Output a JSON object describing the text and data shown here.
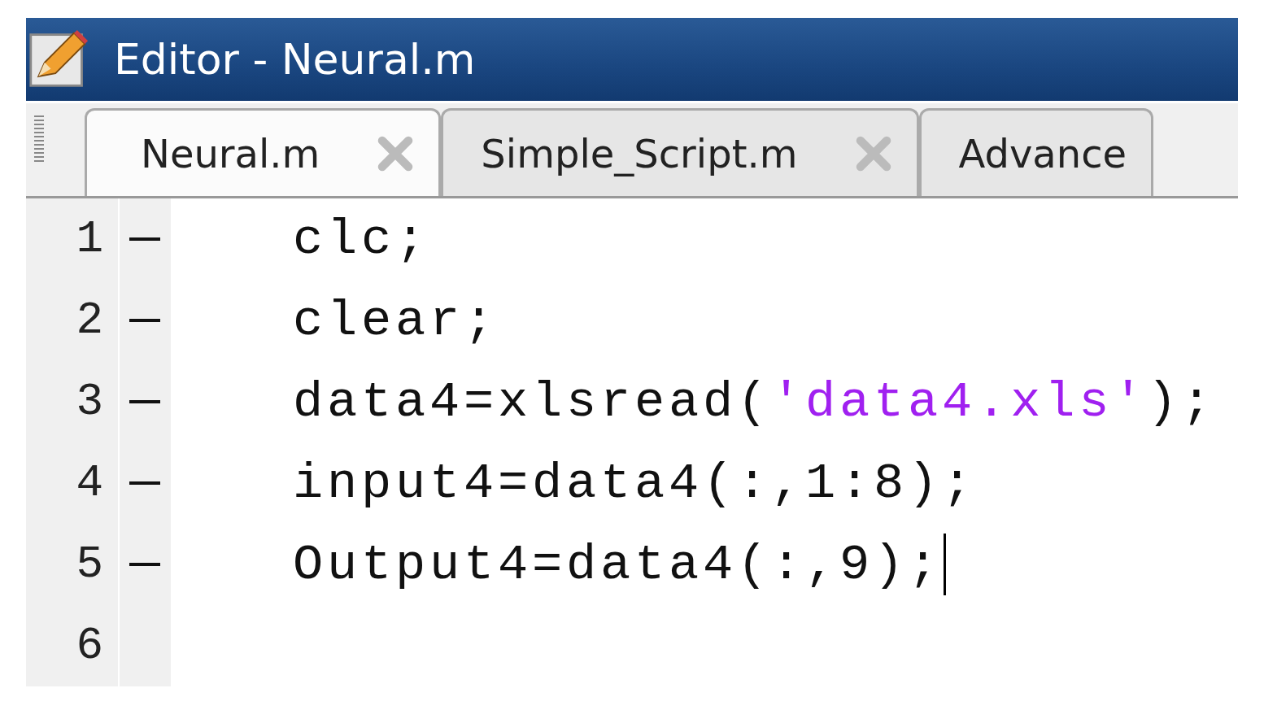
{
  "window": {
    "title": "Editor - Neural.m"
  },
  "tabs": [
    {
      "label": "Neural.m",
      "selected": true,
      "closable": true
    },
    {
      "label": "Simple_Script.m",
      "selected": false,
      "closable": true
    },
    {
      "label": "Advance",
      "selected": false,
      "closable": false
    }
  ],
  "lines": [
    {
      "number": "1",
      "executable": true,
      "cursor": false,
      "segments": [
        {
          "kind": "code",
          "text": "clc;"
        }
      ]
    },
    {
      "number": "2",
      "executable": true,
      "cursor": false,
      "segments": [
        {
          "kind": "code",
          "text": "clear;"
        }
      ]
    },
    {
      "number": "3",
      "executable": true,
      "cursor": false,
      "segments": [
        {
          "kind": "code",
          "text": "data4=xlsread("
        },
        {
          "kind": "string",
          "text": "'data4.xls'"
        },
        {
          "kind": "code",
          "text": ");"
        }
      ]
    },
    {
      "number": "4",
      "executable": true,
      "cursor": false,
      "segments": [
        {
          "kind": "code",
          "text": "input4=data4(:,1:8);"
        }
      ]
    },
    {
      "number": "5",
      "executable": true,
      "cursor": true,
      "segments": [
        {
          "kind": "code",
          "text": "Output4=data4(:,9);"
        }
      ]
    },
    {
      "number": "6",
      "executable": false,
      "cursor": false
    }
  ]
}
